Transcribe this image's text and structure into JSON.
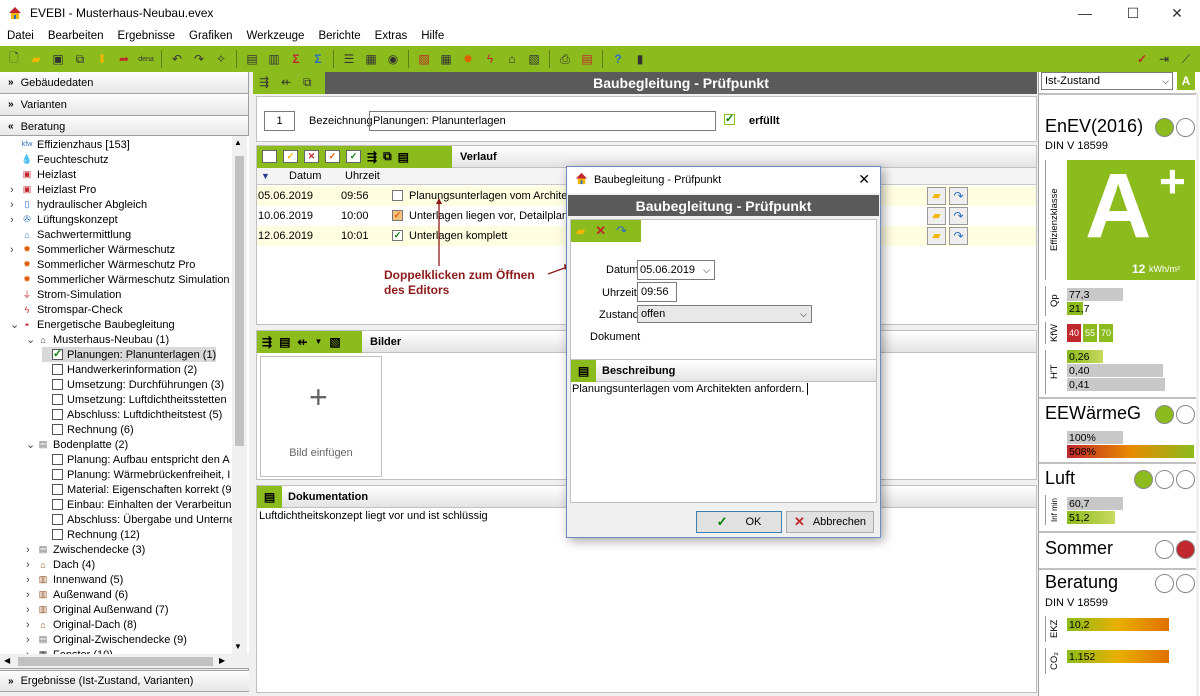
{
  "window": {
    "title": "EVEBI - Musterhaus-Neubau.evex",
    "min": "—",
    "max": "☐",
    "close": "✕"
  },
  "menu": [
    "Datei",
    "Bearbeiten",
    "Ergebnisse",
    "Grafiken",
    "Werkzeuge",
    "Berichte",
    "Extras",
    "Hilfe"
  ],
  "left": {
    "sections": {
      "gebaeude": "Gebäudedaten",
      "varianten": "Varianten",
      "beratung": "Beratung",
      "ergebnisse": "Ergebnisse (Ist-Zustand, Varianten)"
    },
    "tree": [
      {
        "label": "Effizienzhaus [153]",
        "icon": "kfw-icon"
      },
      {
        "label": "Feuchteschutz",
        "icon": "drop-icon"
      },
      {
        "label": "Heizlast",
        "icon": "heizlast-icon"
      },
      {
        "label": "Heizlast Pro",
        "icon": "heizlast-icon"
      },
      {
        "label": "hydraulischer Abgleich",
        "icon": "hydraulic-icon"
      },
      {
        "label": "Lüftungskonzept",
        "icon": "fan-icon"
      },
      {
        "label": "Sachwertermittlung",
        "icon": "euro-house-icon"
      },
      {
        "label": "Sommerlicher Wärmeschutz",
        "icon": "sun-icon"
      },
      {
        "label": "Sommerlicher Wärmeschutz Pro",
        "icon": "sun-icon"
      },
      {
        "label": "Sommerlicher Wärmeschutz Simulation",
        "icon": "sun-icon"
      },
      {
        "label": "Strom-Simulation",
        "icon": "power-icon"
      },
      {
        "label": "Stromspar-Check",
        "icon": "lightning-icon"
      },
      {
        "label": "Energetische Baubegleitung",
        "icon": "helmet-icon"
      },
      {
        "label": "Musterhaus-Neubau (1)",
        "icon": "house-icon"
      },
      {
        "label": "Planungen: Planunterlagen (1)",
        "checked": true
      },
      {
        "label": "Handwerkerinformation (2)"
      },
      {
        "label": "Umsetzung: Durchführungen (3)"
      },
      {
        "label": "Umsetzung: Luftdichtheitsstetten"
      },
      {
        "label": "Abschluss: Luftdichtheitstest (5)"
      },
      {
        "label": "Rechnung (6)"
      },
      {
        "label": "Bodenplatte (2)",
        "icon": "layer-icon"
      },
      {
        "label": "Planung: Aufbau entspricht den A"
      },
      {
        "label": "Planung: Wärmebrückenfreiheit, I"
      },
      {
        "label": "Material: Eigenschaften korrekt (9"
      },
      {
        "label": "Einbau: Einhalten der Verarbeitun"
      },
      {
        "label": "Abschluss: Übergabe und Unterne"
      },
      {
        "label": "Rechnung (12)"
      },
      {
        "label": "Zwischendecke (3)",
        "icon": "layer-icon"
      },
      {
        "label": "Dach (4)",
        "icon": "roof-icon"
      },
      {
        "label": "Innenwand (5)",
        "icon": "wall-icon"
      },
      {
        "label": "Außenwand (6)",
        "icon": "wall-icon"
      },
      {
        "label": "Original Außenwand (7)",
        "icon": "wall-icon"
      },
      {
        "label": "Original-Dach (8)",
        "icon": "roof-icon"
      },
      {
        "label": "Original-Zwischendecke (9)",
        "icon": "layer-icon"
      },
      {
        "label": "Fenster (10)",
        "icon": "window-icon"
      }
    ]
  },
  "center": {
    "title": "Baubegleitung - Prüfpunkt",
    "number": "1",
    "bezeichnung_label": "Bezeichnung",
    "bezeichnung_value": "Planungen: Planunterlagen",
    "erfuellt": "erfüllt",
    "verlauf": {
      "title": "Verlauf",
      "headers": {
        "datum": "Datum",
        "uhrzeit": "Uhrzeit"
      },
      "rows": [
        {
          "datum": "05.06.2019",
          "uhrzeit": "09:56",
          "status": "offen",
          "text": "Planungsunterlagen vom Architekte"
        },
        {
          "datum": "10.06.2019",
          "uhrzeit": "10:00",
          "status": "teil",
          "text": "Unterlagen liegen vor, Detailplanun"
        },
        {
          "datum": "12.06.2019",
          "uhrzeit": "10:01",
          "status": "ok",
          "text": "Unterlagen komplett"
        }
      ]
    },
    "annotation": "Doppelklicken zum Öffnen\ndes Editors",
    "bilder": {
      "title": "Bilder",
      "add_label": "Bild einfügen",
      "plus": "+"
    },
    "dokumentation": {
      "title": "Dokumentation",
      "text": "Luftdichtheitskonzept liegt vor und ist schlüssig"
    }
  },
  "dialog": {
    "window_title": "Baubegleitung - Prüfpunkt",
    "header": "Baubegleitung - Prüfpunkt",
    "datum_label": "Datum",
    "datum_value": "05.06.2019",
    "uhrzeit_label": "Uhrzeit",
    "uhrzeit_value": "09:56",
    "zustand_label": "Zustand",
    "zustand_value": "offen",
    "dokument_label": "Dokument",
    "beschreibung_title": "Beschreibung",
    "beschreibung_text": "Planungsunterlagen vom Architekten anfordern.",
    "ok": "OK",
    "cancel": "Abbrechen"
  },
  "right": {
    "zustand": "Ist-Zustand",
    "enev": {
      "title": "EnEV(2016)",
      "sub": "DIN V 18599",
      "grade": "A",
      "plus": "+",
      "kwh": "12",
      "unit": "kWh/m²",
      "eff_label": "Effizienzklasse"
    },
    "qp": {
      "label": "Qp",
      "v1": "77,3",
      "v2": "21,7"
    },
    "kw": {
      "label": "KfW",
      "c1": "40",
      "c2": "55",
      "c3": "70"
    },
    "ht": {
      "label": "H'T",
      "v1": "0,26",
      "v2": "0,40",
      "v3": "0,41"
    },
    "eew": {
      "title": "EEWärmeG",
      "v1": "100%",
      "v2": "508%"
    },
    "luft": {
      "title": "Luft",
      "label": "Inf min",
      "v1": "60,7",
      "v2": "51,2"
    },
    "sommer": {
      "title": "Sommer"
    },
    "beratung": {
      "title": "Beratung",
      "sub": "DIN V 18599",
      "ekz_label": "EKZ",
      "ekz": "10,2",
      "co2_label": "CO₂",
      "co2": "1.152"
    }
  },
  "colors": {
    "green": "#8cbb1d",
    "dark": "#5a5a5a",
    "red": "#c0282d",
    "yellow_row": "#fffde0"
  }
}
